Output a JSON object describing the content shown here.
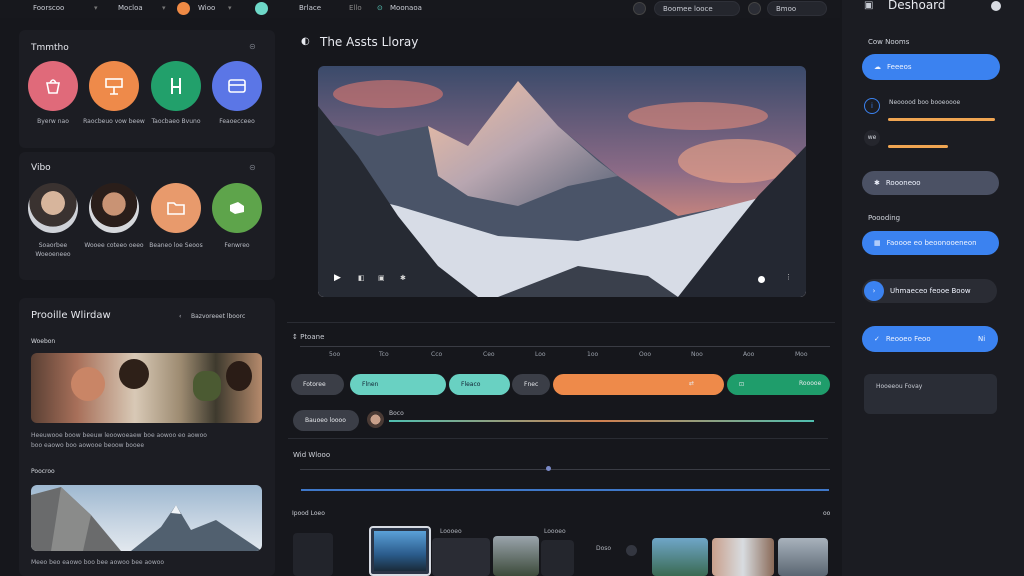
{
  "topbar": {
    "item1": "Foorscoo",
    "item2": "Mocloa",
    "item3": "Wioo",
    "nav1": "Brlace",
    "nav2": "Ello",
    "nav3": "Moonaoa",
    "search1": "Boomee looce",
    "search2": "Bmoo"
  },
  "left": {
    "templates_title": "Tmmtho",
    "templates": [
      {
        "label": "Byerw nao",
        "color": "#e06a7a",
        "icon": "bag-icon"
      },
      {
        "label": "Raocbeuo vow beew",
        "color": "#ee8a4a",
        "icon": "sign-icon"
      },
      {
        "label": "Taocbaeo Bvuno",
        "color": "#22a06b",
        "icon": "tools-icon"
      },
      {
        "label": "Feaoecceeo",
        "color": "#5b76e6",
        "icon": "card-icon"
      }
    ],
    "video_title": "Vibo",
    "videos": [
      {
        "label": "Soaorbee Woeoeneeo"
      },
      {
        "label": "Wooee coteeo oeeo"
      },
      {
        "label": "Beaneo loe Seoos"
      },
      {
        "label": "Fenwreo"
      }
    ],
    "preview_title": "Prooille Wlirdaw",
    "preview_action": "Bazvoreeet lboorc",
    "preview_sub": "Woebon",
    "preview_text1": "Heeuwooe boow beeuw leoowoeaew boe aowoo eo aowoo",
    "preview_text2": "boo eaowo boo aowooe beoow booee",
    "preview_sub2": "Poocroo",
    "preview_text3": "Meeo beo eaowo boo bee aowoo bee aowoo"
  },
  "main": {
    "title": "The Assts Lloray",
    "timeline_label": "Ptoane",
    "ticks": [
      "5oo",
      "Tco",
      "Cco",
      "Ceo",
      "Loo",
      "1oo",
      "Ooo",
      "Noo",
      "Aoo",
      "Moo"
    ],
    "pill1": "Fotoree",
    "pill2": "Flnen",
    "pill3": "Fleaco",
    "pill4": "Fnec",
    "pill5": "Rooooe",
    "audio_pill": "Bauoeo loooo",
    "audio_label": "Boco",
    "audio2_title": "Wid Wlooo",
    "bottom_label": "Ipood Loeo",
    "thumb_label1": "Loooeo",
    "thumb_label2": "Loooeo",
    "thumb_label3": "Doso",
    "bottom_right": "oo"
  },
  "sidebar": {
    "title": "Deshoard",
    "section1": "Cow Nooms",
    "btn1": "Feeeos",
    "item2": "Neooood boo booeoooe",
    "item3": "we",
    "btn4": "Roooneoo",
    "section2": "Poooding",
    "btn5": "Faoooe eo beoonooeneon",
    "btn6": "Uhmaeceo feooe Boow",
    "btn7": "Reooeo Feoo",
    "btn7_badge": "Ni",
    "card_title": "Hooeeou Fovay"
  }
}
